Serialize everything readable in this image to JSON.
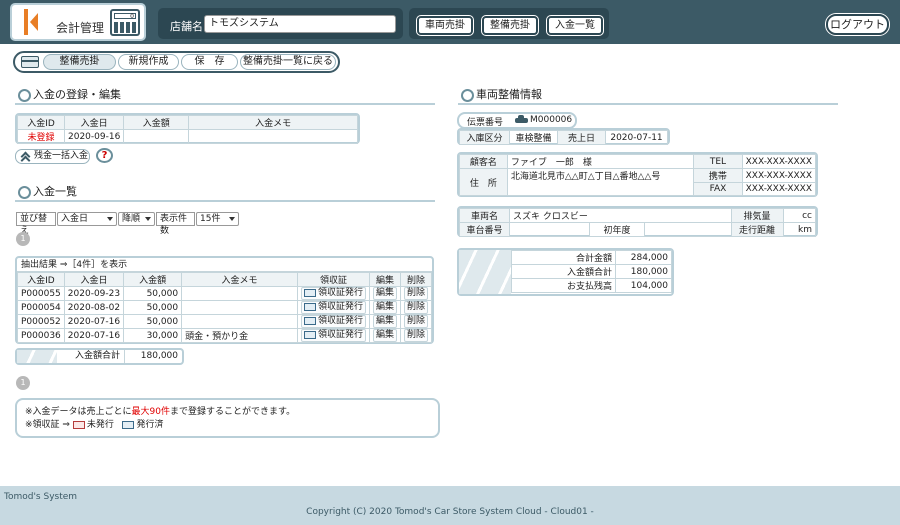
{
  "header": {
    "app_title": "会計管理",
    "calc_display": "0",
    "store_label": "店舗名",
    "store_value": "トモズシステム",
    "nav": [
      "車両売掛",
      "整備売掛",
      "入金一覧"
    ],
    "logout": "ログアウト"
  },
  "subnav": [
    "整備売掛",
    "新規作成",
    "保　存",
    "整備売掛一覧に戻る"
  ],
  "entry": {
    "title": "入金の登録・編集",
    "columns": [
      "入金ID",
      "入金日",
      "入金額",
      "入金メモ"
    ],
    "row": [
      "未登録",
      "2020-09-16",
      "",
      ""
    ],
    "bulk_button": "残金一括入金",
    "help": "?"
  },
  "list": {
    "title": "入金一覧",
    "sort_label": "並び替え",
    "sort_field": "入金日",
    "sort_order": "降順",
    "count_label": "表示件数",
    "count_value": "15件",
    "page": "1",
    "result_text": "抽出結果 ⇒［4件］を表示",
    "columns": [
      "入金ID",
      "入金日",
      "入金額",
      "入金メモ",
      "領収証",
      "編集",
      "削除"
    ],
    "rows": [
      {
        "id": "P000055",
        "date": "2020-09-23",
        "amount": "50,000",
        "memo": "",
        "receipt": "領収証発行",
        "edit": "編集",
        "del": "削除"
      },
      {
        "id": "P000054",
        "date": "2020-08-02",
        "amount": "50,000",
        "memo": "",
        "receipt": "領収証発行",
        "edit": "編集",
        "del": "削除"
      },
      {
        "id": "P000052",
        "date": "2020-07-16",
        "amount": "50,000",
        "memo": "",
        "receipt": "領収証発行",
        "edit": "編集",
        "del": "削除"
      },
      {
        "id": "P000036",
        "date": "2020-07-16",
        "amount": "30,000",
        "memo": "頭金・預かり金",
        "receipt": "領収証発行",
        "edit": "編集",
        "del": "削除"
      }
    ],
    "total_label": "入金額合計",
    "total_value": "180,000",
    "page_bottom": "1"
  },
  "notes": {
    "line1_a": "※入金データは売上ごとに",
    "line1_red": "最大90件",
    "line1_b": "まで登録することができます。",
    "line2_a": "※領収証 ⇒",
    "unissued": "未発行",
    "issued": "発行済"
  },
  "vehicle": {
    "title": "車両整備情報",
    "slip_label": "伝票番号",
    "slip_no": "M000006",
    "entry_type_label": "入庫区分",
    "entry_type": "車検整備",
    "sale_date_label": "売上日",
    "sale_date": "2020-07-11",
    "customer_label": "顧客名",
    "customer": "ファイブ　一郎　様",
    "address_label": "住　所",
    "address": "北海道北見市△△町△丁目△番地△△号",
    "tel_label": "TEL",
    "tel": "XXX-XXX-XXXX",
    "mobile_label": "携帯",
    "mobile": "XXX-XXX-XXXX",
    "fax_label": "FAX",
    "fax": "XXX-XXX-XXXX",
    "car_name_label": "車両名",
    "car_name": "スズキ クロスビー",
    "displacement_label": "排気量",
    "displacement_unit": "cc",
    "chassis_label": "車台番号",
    "first_year_label": "初年度",
    "mileage_label": "走行距離",
    "mileage_unit": "km",
    "totals": [
      {
        "label": "合計金額",
        "value": "284,000"
      },
      {
        "label": "入金額合計",
        "value": "180,000"
      },
      {
        "label": "お支払残高",
        "value": "104,000"
      }
    ]
  },
  "footer": {
    "logo": "Tomod's System",
    "copyright": "Copyright (C) 2020 Tomod's Car Store System Cloud - Cloud01 -"
  }
}
